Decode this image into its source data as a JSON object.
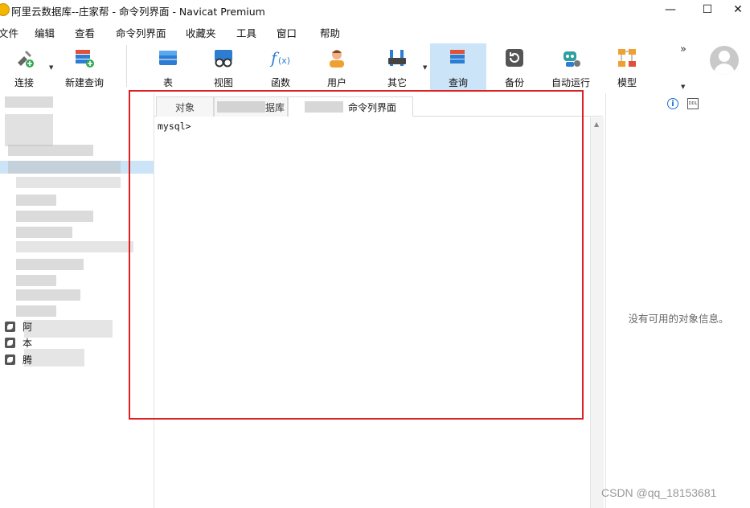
{
  "window": {
    "title": "阿里云数据库--庄家帮 - 命令列界面 - Navicat Premium",
    "minimize": "—",
    "maximize": "☐",
    "close": "✕"
  },
  "menu": [
    "文件",
    "编辑",
    "查看",
    "命令列界面",
    "收藏夹",
    "工具",
    "窗口",
    "帮助"
  ],
  "toolbar": {
    "connect": "连接",
    "new_query": "新建查询",
    "table": "表",
    "view": "视图",
    "function": "函数",
    "user": "用户",
    "other": "其它",
    "query": "查询",
    "backup": "备份",
    "auto_run": "自动运行",
    "model": "模型",
    "overflow": "»"
  },
  "tree": {
    "visible_labels": [
      "阿",
      "本",
      "腾"
    ]
  },
  "tabs": {
    "objects": "对象",
    "blurred_tab": "据库",
    "cli": "命令列界面"
  },
  "console": {
    "prompt": "mysql>"
  },
  "right_pane": {
    "no_info": "没有可用的对象信息。",
    "info_icon": "i",
    "ddl_icon": "DDL"
  },
  "watermark": "CSDN @qq_18153681",
  "colors": {
    "accent_blue": "#1a6fd1",
    "active_tab_bg": "#cce4f7",
    "highlight_box": "#e02020"
  }
}
